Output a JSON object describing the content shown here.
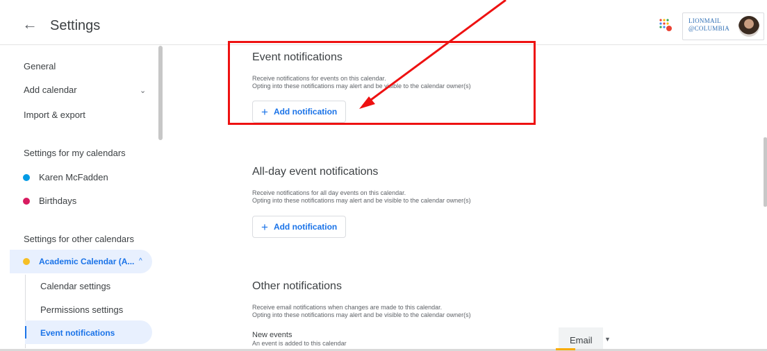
{
  "header": {
    "back_icon": "←",
    "title": "Settings",
    "brand_line1": "LIONMAIL",
    "brand_line2": "@COLUMBIA"
  },
  "sidebar": {
    "general": "General",
    "add_calendar": "Add calendar",
    "import_export": "Import & export",
    "my_calendars_heading": "Settings for my calendars",
    "my_calendars": [
      {
        "label": "Karen McFadden",
        "color": "#039be5"
      },
      {
        "label": "Birthdays",
        "color": "#d81b60"
      }
    ],
    "other_calendars_heading": "Settings for other calendars",
    "other_calendar": {
      "label": "Academic Calendar (A...",
      "color": "#f6bf26"
    },
    "sub_items": [
      "Calendar settings",
      "Permissions settings",
      "Event notifications"
    ]
  },
  "main": {
    "event_notifications": {
      "title": "Event notifications",
      "desc1": "Receive notifications for events on this calendar.",
      "desc2": "Opting into these notifications may alert and be visible to the calendar owner(s)",
      "button": "Add notification"
    },
    "allday_notifications": {
      "title": "All-day event notifications",
      "desc1": "Receive notifications for all day events on this calendar.",
      "desc2": "Opting into these notifications may alert and be visible to the calendar owner(s)",
      "button": "Add notification"
    },
    "other_notifications": {
      "title": "Other notifications",
      "desc1": "Receive email notifications when changes are made to this calendar.",
      "desc2": "Opting into these notifications may alert and be visible to the calendar owner(s)",
      "row_title": "New events",
      "row_desc": "An event is added to this calendar",
      "select_value": "Email"
    }
  },
  "colors": {
    "accent": "#1a73e8",
    "highlight_red": "#ee1111",
    "selected_bg": "#e8f0fe"
  }
}
